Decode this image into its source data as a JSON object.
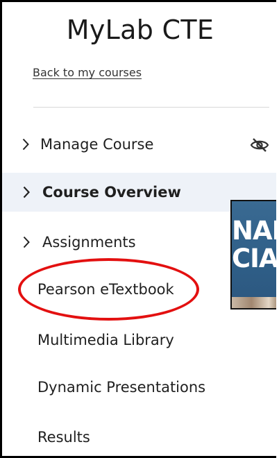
{
  "app": {
    "title": "MyLab CTE",
    "back_link": "Back to my courses"
  },
  "nav": {
    "items": [
      {
        "label": "Manage Course",
        "expandable": true,
        "active": false,
        "trailing_icon": "eye-slash-icon"
      },
      {
        "label": "Course Overview",
        "expandable": true,
        "active": true
      },
      {
        "label": "Assignments",
        "expandable": true,
        "active": false
      },
      {
        "label": "Pearson eTextbook",
        "expandable": false,
        "active": false,
        "highlighted": true
      },
      {
        "label": "Multimedia Library",
        "expandable": false,
        "active": false
      },
      {
        "label": "Dynamic Presentations",
        "expandable": false,
        "active": false
      },
      {
        "label": "Results",
        "expandable": false,
        "active": false
      }
    ]
  },
  "thumbnail": {
    "line1": "NAL",
    "line2": "CIAL"
  },
  "colors": {
    "active_bg": "#eef2f8",
    "highlight_ring": "#e31010",
    "text": "#1f1f1f",
    "thumb_blue": "#2f5f88"
  }
}
